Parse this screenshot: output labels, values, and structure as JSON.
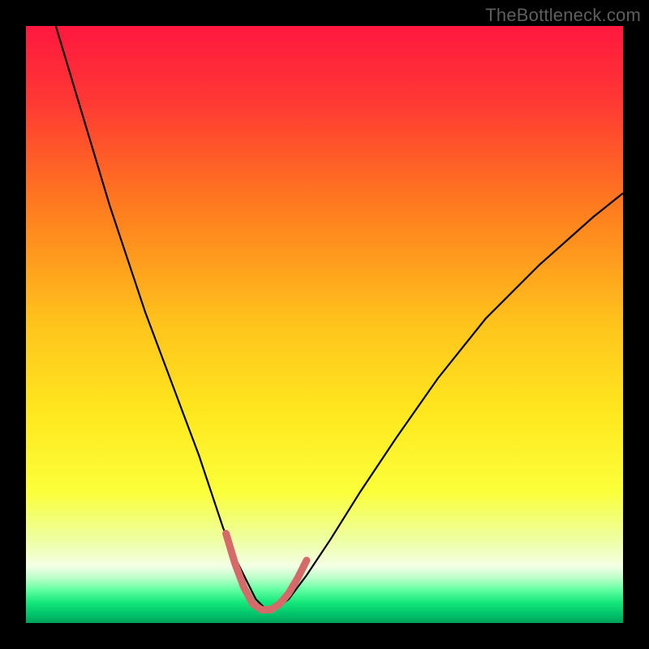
{
  "watermark": {
    "text": "TheBottleneck.com"
  },
  "chart_data": {
    "type": "line",
    "title": "",
    "xlabel": "",
    "ylabel": "",
    "xlim": [
      0,
      100
    ],
    "ylim": [
      0,
      100
    ],
    "axes_visible": false,
    "grid": false,
    "gradient_stops": [
      {
        "offset": 0.0,
        "color": "#ff183f"
      },
      {
        "offset": 0.12,
        "color": "#ff3635"
      },
      {
        "offset": 0.3,
        "color": "#ff7a1f"
      },
      {
        "offset": 0.5,
        "color": "#ffc41c"
      },
      {
        "offset": 0.65,
        "color": "#ffe81f"
      },
      {
        "offset": 0.78,
        "color": "#fbff3a"
      },
      {
        "offset": 0.86,
        "color": "#eeffa2"
      },
      {
        "offset": 0.905,
        "color": "#f3ffe5"
      },
      {
        "offset": 0.925,
        "color": "#b8ffc8"
      },
      {
        "offset": 0.945,
        "color": "#5fffa0"
      },
      {
        "offset": 0.965,
        "color": "#17e87c"
      },
      {
        "offset": 0.985,
        "color": "#00c46a"
      },
      {
        "offset": 1.0,
        "color": "#00a05a"
      }
    ],
    "series": [
      {
        "name": "bottleneck-curve",
        "color": "#000000",
        "width": 2.2,
        "x": [
          5,
          8,
          11,
          14,
          17,
          20,
          23,
          26,
          29,
          31,
          33,
          35,
          37,
          38.5,
          40,
          42,
          44,
          47,
          51,
          56,
          62,
          69,
          77,
          86,
          95,
          100
        ],
        "y": [
          100,
          90,
          80,
          70,
          61,
          52,
          44,
          36,
          28,
          22,
          16,
          11,
          7,
          4,
          2.5,
          2.5,
          4,
          8,
          14,
          22,
          31,
          41,
          51,
          60,
          68,
          72
        ]
      },
      {
        "name": "trough-highlight",
        "color": "#d66a6a",
        "width": 9,
        "linecap": "round",
        "x": [
          33.5,
          35,
          36.5,
          38,
          39.5,
          41,
          42.5,
          44,
          45.5,
          47
        ],
        "y": [
          15,
          10,
          6,
          3.2,
          2.2,
          2.2,
          3.2,
          5,
          7.5,
          10.5
        ]
      }
    ],
    "annotations": []
  }
}
